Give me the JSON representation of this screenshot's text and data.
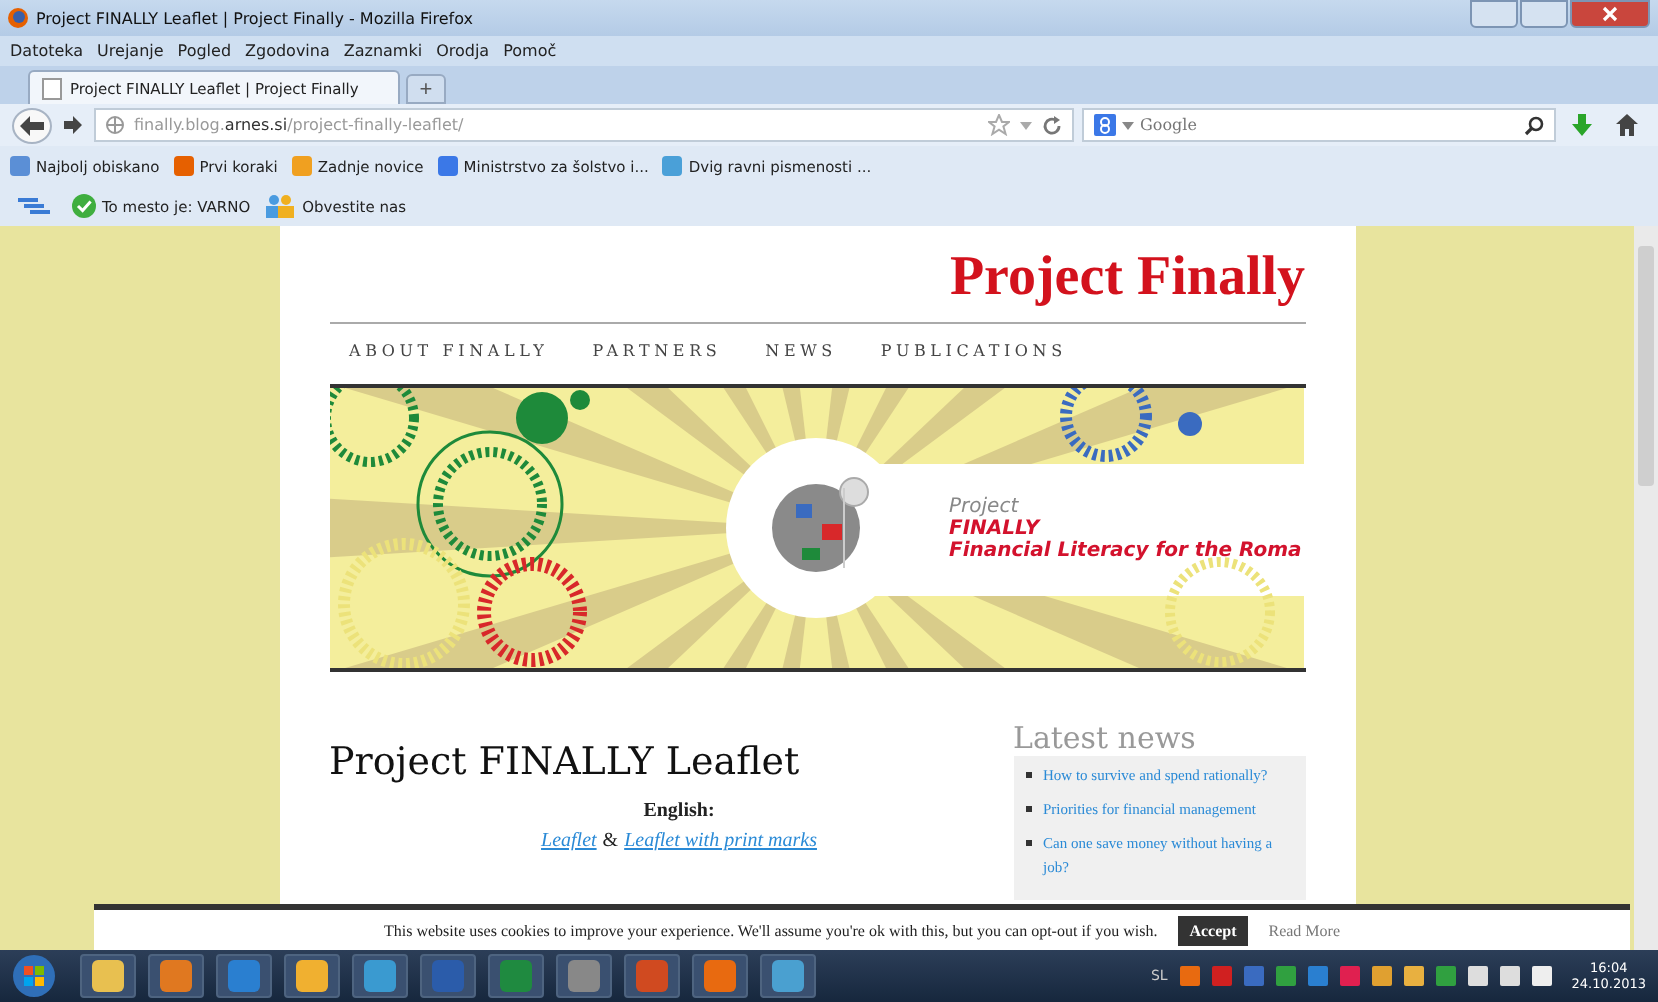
{
  "window": {
    "title": "Project FINALLY Leaflet | Project Finally - Mozilla Firefox"
  },
  "menu_bar": [
    "Datoteka",
    "Urejanje",
    "Pogled",
    "Zgodovina",
    "Zaznamki",
    "Orodja",
    "Pomoč"
  ],
  "tabs": [
    {
      "label": "Project FINALLY Leaflet | Project Finally",
      "selected": true
    }
  ],
  "new_tab": "+",
  "address_bar": {
    "url": "finally.blog.**arnes.si**/project-finally-leaflet/"
  },
  "search": {
    "placeholder": "Google"
  },
  "bookmarks": [
    "Najbolj obiskano",
    "Prvi koraki",
    "Zadnje novice",
    "Ministrstvo za šolstvo i...",
    "Dvig ravni pismenosti ..."
  ],
  "addon_bar": [
    "To mesto je: VARNO",
    "Obvestite nas"
  ],
  "page": {
    "site_title": "Project Finally",
    "nav": [
      "ABOUT FINALLY",
      "PARTNERS",
      "NEWS",
      "PUBLICATIONS"
    ],
    "banner": {
      "line_1": "Project",
      "line_2": "FINALLY",
      "line_3": "Financial Literacy for the Roma"
    },
    "article": {
      "title": "Project FINALLY Leaflet",
      "heading": "English:",
      "links": [
        "Leaflet",
        "Leaflet with print marks"
      ],
      "separator": "&"
    },
    "sidebar": {
      "title": "Latest news",
      "news": [
        "How to survive and spend rationally?",
        "Priorities for financial management",
        "Can one save money without having a job?"
      ]
    }
  },
  "cookie_bar": {
    "message": "This website uses cookies to improve your experience. We'll assume you're ok with this, but you can opt-out if you wish.",
    "accept": "Accept",
    "read_more": "Read More"
  },
  "taskbar": {
    "language": "SL",
    "time": "16:04",
    "date": "24.10.2013"
  }
}
